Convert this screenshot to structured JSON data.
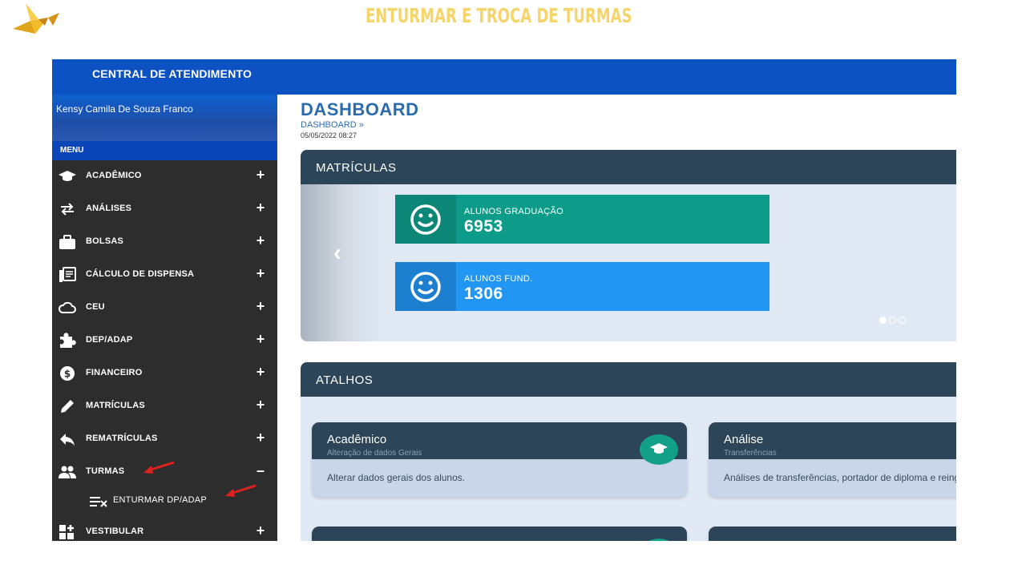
{
  "slide": {
    "title": "ENTURMAR E TROCA DE TURMAS"
  },
  "app": {
    "header_title": "CENTRAL DE ATENDIMENTO",
    "user_name": "Kensy Camila De Souza Franco",
    "menu_label": "MENU"
  },
  "sidebar": {
    "items": [
      {
        "label": "ACADÊMICO",
        "icon": "graduation-cap-icon",
        "toggle": "+"
      },
      {
        "label": "ANÁLISES",
        "icon": "exchange-arrows-icon",
        "toggle": "+"
      },
      {
        "label": "BOLSAS",
        "icon": "briefcase-icon",
        "toggle": "+"
      },
      {
        "label": "CÁLCULO DE DISPENSA",
        "icon": "document-list-icon",
        "toggle": "+"
      },
      {
        "label": "CEU",
        "icon": "cloud-icon",
        "toggle": "+"
      },
      {
        "label": "DEP/ADAP",
        "icon": "puzzle-piece-icon",
        "toggle": "+"
      },
      {
        "label": "FINANCEIRO",
        "icon": "dollar-circle-icon",
        "toggle": "+"
      },
      {
        "label": "MATRÍCULAS",
        "icon": "pencil-icon",
        "toggle": "+"
      },
      {
        "label": "REMATRÍCULAS",
        "icon": "reply-arrow-icon",
        "toggle": "+"
      },
      {
        "label": "TURMAS",
        "icon": "users-icon",
        "toggle": "–"
      },
      {
        "label": "VESTIBULAR",
        "icon": "grid-plus-icon",
        "toggle": "+"
      }
    ],
    "subitem": {
      "label": "ENTURMAR DP/ADAP",
      "icon": "list-remove-icon"
    }
  },
  "main": {
    "page_title": "DASHBOARD",
    "breadcrumb": "DASHBOARD »",
    "datetime": "05/05/2022 08:27"
  },
  "matriculas": {
    "title": "MATRÍCULAS",
    "stats": [
      {
        "label": "ALUNOS GRADUAÇÃO",
        "value": "6953",
        "color": "#0e9c8a",
        "icon_bg": "#0b8677"
      },
      {
        "label": "ALUNOS FUND.",
        "value": "1306",
        "color": "#2196f3",
        "icon_bg": "#1c7fd0"
      }
    ],
    "carousel_active_index": 0,
    "carousel_count": 3
  },
  "atalhos": {
    "title": "ATALHOS",
    "cards": [
      {
        "title": "Acadêmico",
        "subtitle": "Alteração de dados Gerais",
        "body": "Alterar dados gerais dos alunos."
      },
      {
        "title": "Análise",
        "subtitle": "Transferências",
        "body": "Análises de transferências, portador de diploma e reingresso no curso."
      }
    ]
  },
  "colors": {
    "topbar": "#0d52c3",
    "sidebar": "#2d2d2d",
    "panel_header": "#2c4558",
    "accent_title": "#f5d46a",
    "annotation_arrow": "#e02020"
  }
}
